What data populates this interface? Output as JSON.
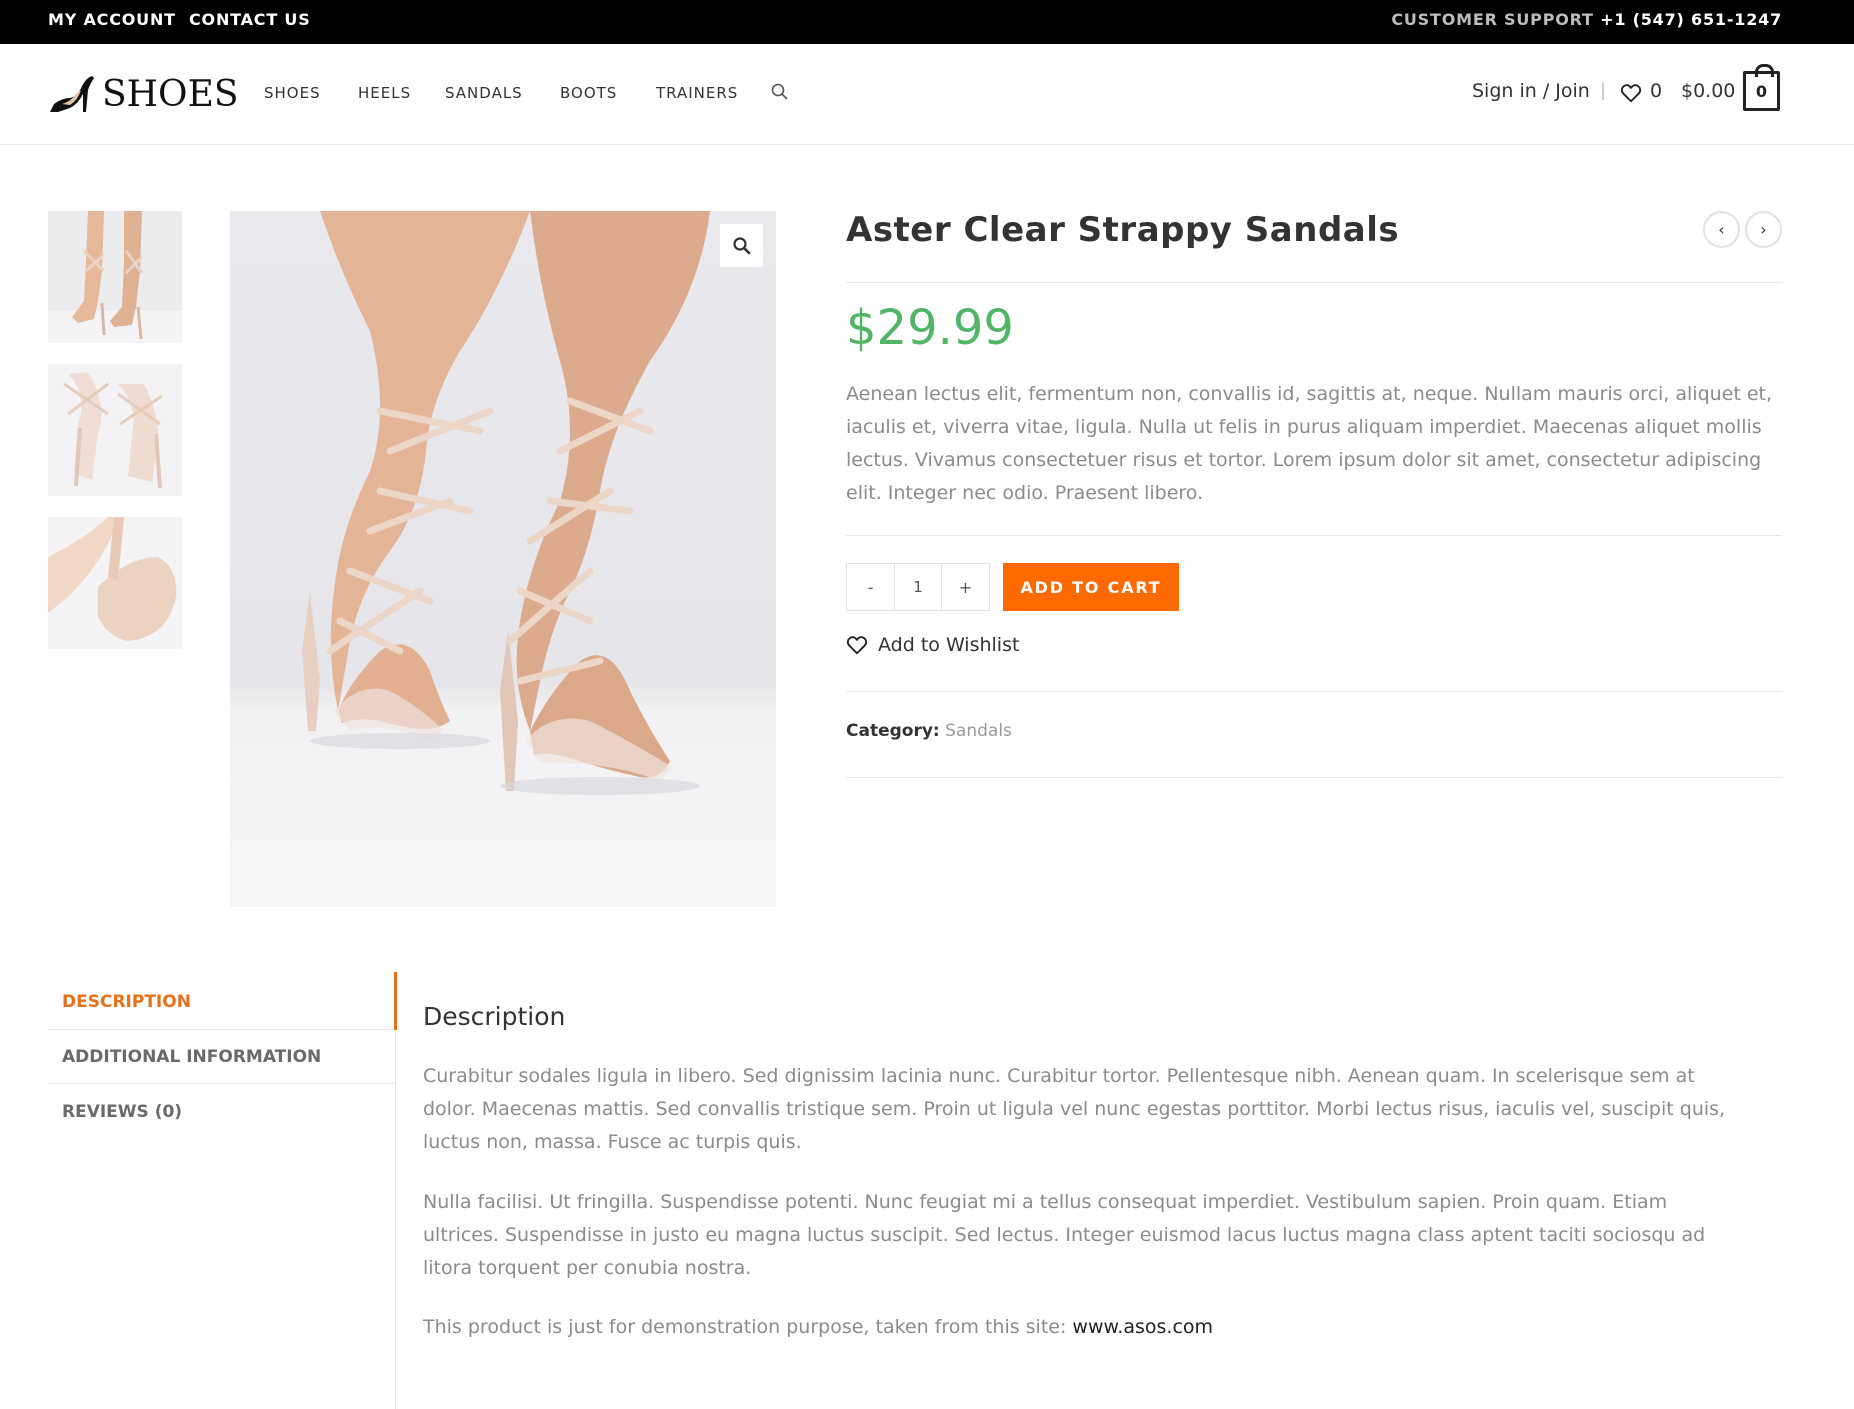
{
  "topbar": {
    "my_account": "MY ACCOUNT",
    "contact_us": "CONTACT US",
    "support_label": "CUSTOMER SUPPORT",
    "support_phone": "+1 (547) 651-1247"
  },
  "header": {
    "logo_text": "SHOES",
    "nav": [
      "SHOES",
      "HEELS",
      "SANDALS",
      "BOOTS",
      "TRAINERS"
    ],
    "search_icon": "search-icon",
    "signin": "Sign in / Join",
    "separator": "|",
    "wishlist_count": "0",
    "cart_total": "$0.00",
    "cart_count": "0"
  },
  "product": {
    "title": "Aster Clear Strappy Sandals",
    "price": "$29.99",
    "short_description": "Aenean lectus elit, fermentum non, convallis id, sagittis at, neque. Nullam mauris orci, aliquet et, iaculis et, viverra vitae, ligula. Nulla ut felis in purus aliquam imperdiet. Maecenas aliquet mollis lectus. Vivamus consectetuer risus et tortor. Lorem ipsum dolor sit amet, consectetur adipiscing elit. Integer nec odio. Praesent libero.",
    "qty_minus": "-",
    "qty_value": "1",
    "qty_plus": "+",
    "add_to_cart": "ADD TO CART",
    "add_to_wishlist": "Add to Wishlist",
    "category_label": "Category:",
    "category_value": "Sandals",
    "prev_icon": "‹",
    "next_icon": "›"
  },
  "tabs": [
    {
      "label": "DESCRIPTION",
      "active": true
    },
    {
      "label": "ADDITIONAL INFORMATION",
      "active": false
    },
    {
      "label": "REVIEWS (0)",
      "active": false
    }
  ],
  "panel": {
    "title": "Description",
    "paragraph_1": "Curabitur sodales ligula in libero. Sed dignissim lacinia nunc. Curabitur tortor. Pellentesque nibh. Aenean quam. In scelerisque sem at dolor. Maecenas mattis. Sed convallis tristique sem. Proin ut ligula vel nunc egestas porttitor. Morbi lectus risus, iaculis vel, suscipit quis, luctus non, massa. Fusce ac turpis quis.",
    "paragraph_2": "Nulla facilisi. Ut fringilla. Suspendisse potenti. Nunc feugiat mi a tellus consequat imperdiet. Vestibulum sapien. Proin quam. Etiam ultrices. Suspendisse in justo eu magna luctus suscipit. Sed lectus. Integer euismod lacus luctus magna class aptent taciti sociosqu ad litora torquent per conubia nostra.",
    "note_text": "This product is just for demonstration purpose, taken from this site: ",
    "note_link": "www.asos.com"
  },
  "colors": {
    "accent": "#ff6a00",
    "tab_active": "#e8701a",
    "price": "#52b565",
    "topbar_bg": "#000000"
  }
}
